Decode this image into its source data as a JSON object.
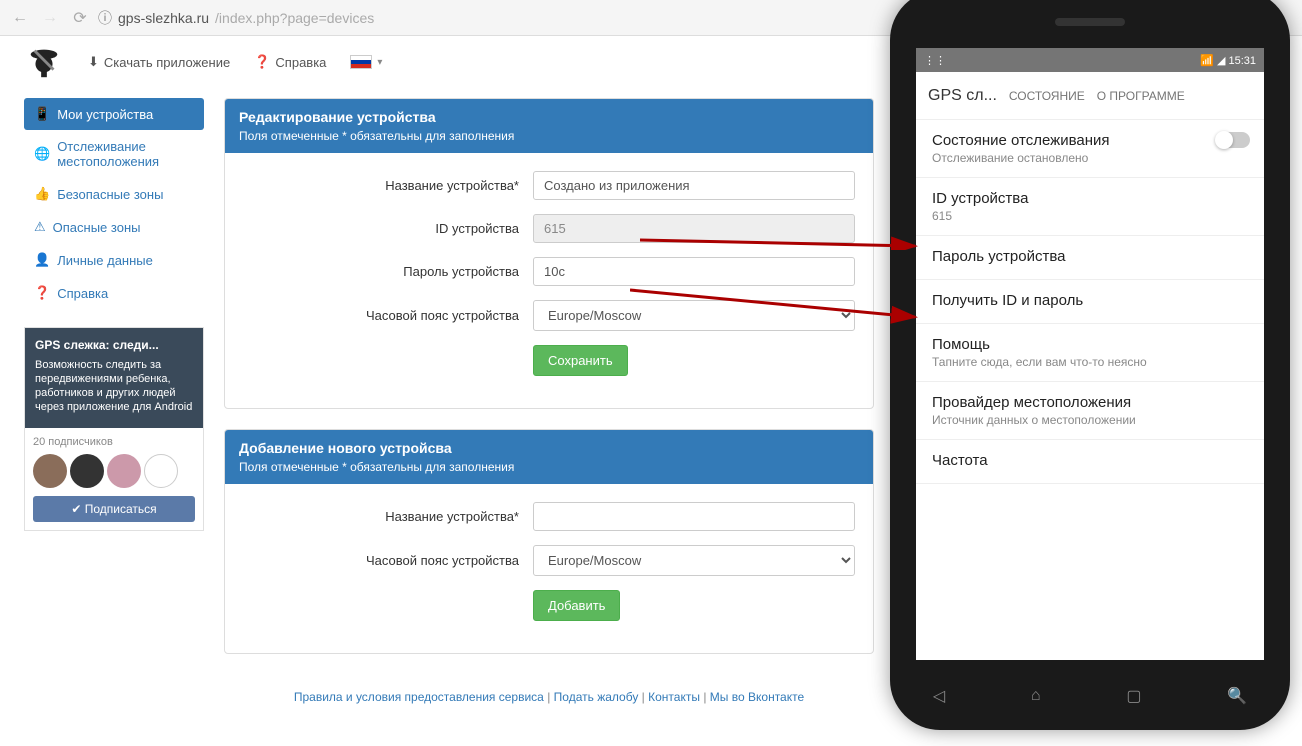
{
  "browser": {
    "url_prefix": "gps-slezhka.ru",
    "url_path": "/index.php?page=devices"
  },
  "topnav": {
    "download": "Скачать приложение",
    "help": "Справка"
  },
  "sidebar": {
    "items": [
      {
        "label": "Мои устройства",
        "icon": "phone"
      },
      {
        "label": "Отслеживание местоположения",
        "icon": "globe"
      },
      {
        "label": "Безопасные зоны",
        "icon": "thumbs-up"
      },
      {
        "label": "Опасные зоны",
        "icon": "warning"
      },
      {
        "label": "Личные данные",
        "icon": "user"
      },
      {
        "label": "Справка",
        "icon": "question"
      }
    ]
  },
  "vk": {
    "title": "GPS слежка: следи...",
    "desc": "Возможность следить за передвижениями ребенка, работников и других людей через приложение для Android",
    "subs": "20 подписчиков",
    "btn": "Подписаться"
  },
  "panel_edit": {
    "title": "Редактирование устройства",
    "subtitle": "Поля отмеченные * обязательны для заполнения",
    "name_label": "Название устройства*",
    "name_value": "Создано из приложения",
    "id_label": "ID устройства",
    "id_value": "615",
    "pass_label": "Пароль устройства",
    "pass_value": "10c",
    "tz_label": "Часовой пояс устройства",
    "tz_value": "Europe/Moscow",
    "save": "Сохранить"
  },
  "panel_add": {
    "title": "Добавление нового устройсва",
    "subtitle": "Поля отмеченные * обязательны для заполнения",
    "name_label": "Название устройства*",
    "tz_label": "Часовой пояс устройства",
    "tz_value": "Europe/Moscow",
    "add": "Добавить"
  },
  "footer": {
    "terms": "Правила и условия предоставления сервиса",
    "complaint": "Подать жалобу",
    "contacts": "Контакты",
    "vk": "Мы во Вконтакте"
  },
  "phone": {
    "status_time": "15:31",
    "app_title": "GPS сл...",
    "tab1": "СОСТОЯНИЕ",
    "tab2": "О ПРОГРАММЕ",
    "items": [
      {
        "title": "Состояние отслеживания",
        "sub": "Отслеживание остановлено",
        "toggle": true
      },
      {
        "title": "ID устройства",
        "sub": "615"
      },
      {
        "title": "Пароль устройства",
        "sub": ""
      },
      {
        "title": "Получить ID и пароль",
        "sub": ""
      },
      {
        "title": "Помощь",
        "sub": "Тапните сюда, если вам что-то неясно"
      },
      {
        "title": "Провайдер местоположения",
        "sub": "Источник данных о местоположении"
      },
      {
        "title": "Частота",
        "sub": ""
      }
    ]
  }
}
